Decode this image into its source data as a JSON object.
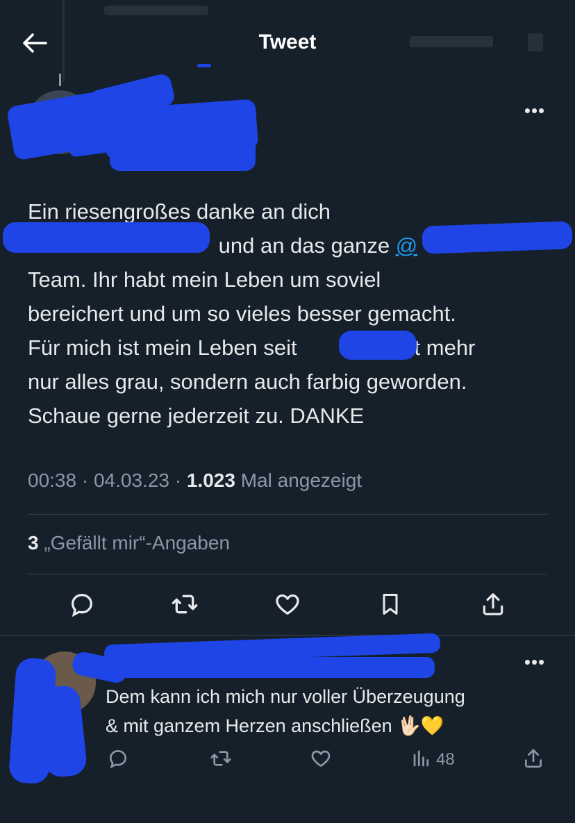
{
  "header": {
    "title": "Tweet"
  },
  "tweet": {
    "text_lines": [
      "Ein riesengroßes danke an dich",
      "und an das ganze",
      "Team. Ihr habt mein Leben um soviel",
      "bereichert und um so vieles besser gemacht.",
      "Für mich ist mein Leben seit",
      "nicht mehr",
      "nur alles grau, sondern auch farbig geworden.",
      "Schaue gerne jederzeit zu. DANKE"
    ],
    "mention_visible": "@",
    "time": "00:38",
    "date": "04.03.23",
    "separator": " · ",
    "views_count": "1.023",
    "views_label": "Mal angezeigt",
    "likes_count": "3",
    "likes_label": "„Gefällt mir“-Angaben",
    "more_label": "•••"
  },
  "reply": {
    "text_lines": [
      "Dem kann ich mich nur voller Überzeugung",
      "& mit ganzem Herzen anschließen 🖖🏻💛"
    ],
    "views": "48",
    "more_label": "•••"
  },
  "icons": {
    "back": "arrow-left-icon",
    "reply": "reply-icon",
    "retweet": "retweet-icon",
    "like": "heart-icon",
    "bookmark": "bookmark-icon",
    "share": "share-icon",
    "views": "views-icon",
    "more": "more-icon"
  },
  "colors": {
    "background": "#15202b",
    "text": "#e7e9ea",
    "secondary": "#8b98a5",
    "link": "#1d9bf0",
    "divider": "#38444d",
    "redaction": "#1f45e6"
  }
}
